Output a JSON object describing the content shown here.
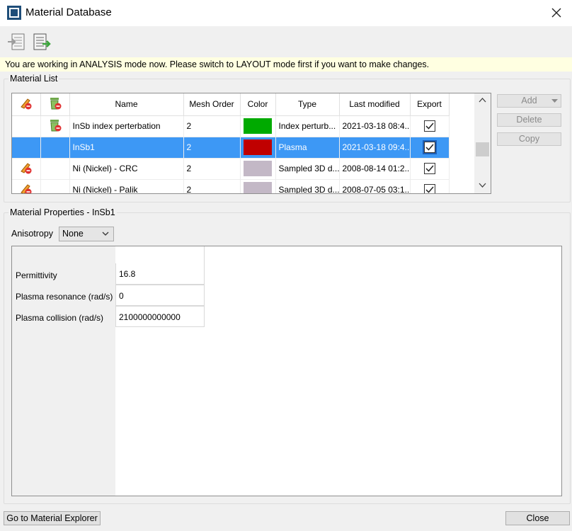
{
  "window": {
    "title": "Material Database"
  },
  "banner": {
    "text": "You are working in ANALYSIS mode now. Please switch to LAYOUT mode first if you want to make changes."
  },
  "material_list": {
    "title": "Material List",
    "columns": [
      "Name",
      "Mesh Order",
      "Color",
      "Type",
      "Last modified",
      "Export"
    ],
    "rows": [
      {
        "name": "InSb index perterbation",
        "mesh": "2",
        "color": "#00aa00",
        "type": "Index perturb...",
        "modified": "2021-03-18 08:4...",
        "export": true,
        "selected": false,
        "icons": [
          "delete-material-icon"
        ]
      },
      {
        "name": "InSb1",
        "mesh": "2",
        "color": "#c00000",
        "type": "Plasma",
        "modified": "2021-03-18 09:4...",
        "export": true,
        "selected": true,
        "icons": []
      },
      {
        "name": "Ni (Nickel) - CRC",
        "mesh": "2",
        "color": "#c3b8c6",
        "type": "Sampled 3D d...",
        "modified": "2008-08-14 01:2...",
        "export": true,
        "selected": false,
        "icons": [
          "edit-locked-icon"
        ]
      },
      {
        "name": "Ni (Nickel) - Palik",
        "mesh": "2",
        "color": "#c3b8c6",
        "type": "Sampled 3D d...",
        "modified": "2008-07-05 03:1...",
        "export": true,
        "selected": false,
        "icons": [
          "edit-locked-icon"
        ]
      }
    ],
    "buttons": {
      "add": "Add",
      "delete": "Delete",
      "copy": "Copy"
    }
  },
  "properties": {
    "title": "Material Properties - InSb1",
    "anisotropy_label": "Anisotropy",
    "anisotropy_value": "None",
    "fields": [
      {
        "label": "Permittivity",
        "value": "16.8"
      },
      {
        "label": "Plasma resonance (rad/s)",
        "value": "0"
      },
      {
        "label": "Plasma collision (rad/s)",
        "value": "2100000000000"
      }
    ]
  },
  "footer": {
    "explorer_button": "Go to Material Explorer",
    "close_button": "Close"
  }
}
